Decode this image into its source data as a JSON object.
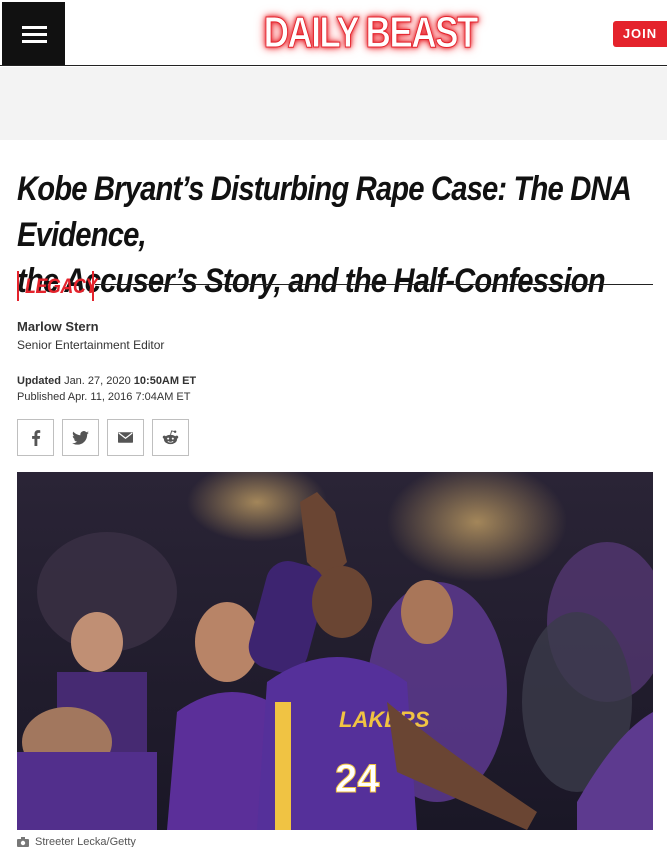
{
  "header": {
    "logo_text": "DAILY BEAST",
    "join_label": "JOIN",
    "menu_icon": "hamburger-icon",
    "accent_color": "#e4232c"
  },
  "article": {
    "headline_line1": "Kobe Bryant’s Disturbing Rape Case: The DNA Evidence,",
    "headline_line2": "the Accuser’s Story, and the Half-Confession",
    "section": "LEGACY",
    "author_name": "Marlow Stern",
    "author_title": "Senior Entertainment Editor",
    "updated_label": "Updated",
    "updated_date": "Jan. 27, 2020",
    "updated_time": "10:50AM ET",
    "published_label": "Published",
    "published_date": "Apr. 11, 2016 7:04AM ET",
    "share_icons": [
      "facebook-icon",
      "twitter-icon",
      "email-icon",
      "reddit-icon"
    ],
    "hero_caption": "Streeter Lecka/Getty",
    "jersey_number": "24",
    "jersey_team": "LAKERS"
  }
}
